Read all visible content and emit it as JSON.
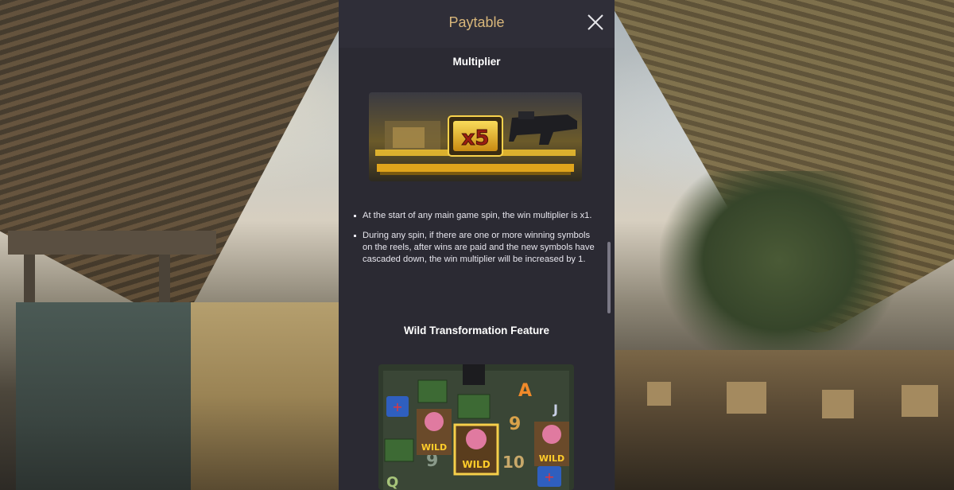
{
  "panel": {
    "title": "Paytable",
    "close_icon": "close-icon"
  },
  "sections": {
    "multiplier": {
      "title": "Multiplier",
      "image_badge": "x5",
      "bullets": [
        "At the start of any main game spin, the win multiplier is x1.",
        "During any spin, if there are one or more winning symbols on the reels, after wins are paid and the new symbols have cascaded down, the win multiplier will be increased by 1."
      ]
    },
    "wild": {
      "title": "Wild Transformation Feature",
      "image_labels": {
        "wild": "WILD",
        "letter_a": "A",
        "letter_j": "J",
        "letter_q": "Q",
        "nine": "9",
        "ten": "10"
      }
    }
  },
  "colors": {
    "panel_bg": "#2b2a33",
    "title": "#d8b67a",
    "gold": "#f2c230"
  }
}
